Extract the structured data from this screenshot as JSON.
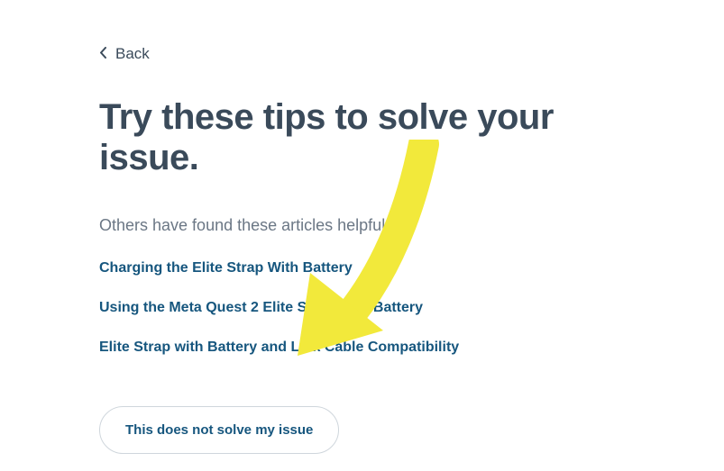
{
  "back": {
    "label": "Back"
  },
  "title": "Try these tips to solve your issue.",
  "subtitle": "Others have found these articles helpful.",
  "articles": [
    {
      "label": "Charging the Elite Strap With Battery"
    },
    {
      "label": "Using the Meta Quest 2 Elite Strap With Battery"
    },
    {
      "label": "Elite Strap with Battery and Link Cable Compatibility"
    }
  ],
  "notSolveButton": {
    "label": "This does not solve my issue"
  },
  "annotation": {
    "arrowColor": "#f2e93b"
  }
}
